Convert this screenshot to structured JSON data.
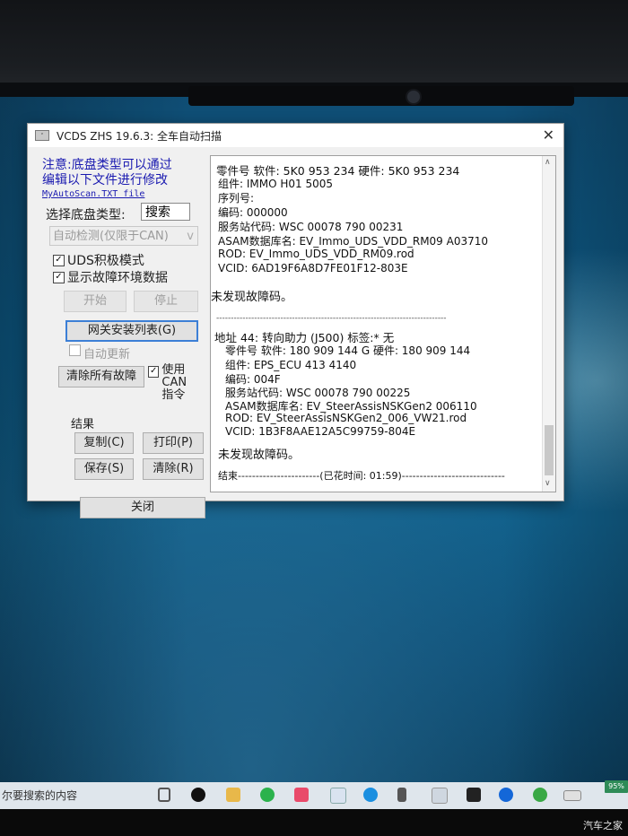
{
  "window": {
    "title": "VCDS ZHS 19.6.3:  全车自动扫描",
    "close_glyph": "✕"
  },
  "left": {
    "note_line1": "注意:底盘类型可以通过",
    "note_line2": "编辑以下文件进行修改",
    "note_file": "MyAutoScan.TXT file",
    "chassis_label": "选择底盘类型:",
    "search_button": "搜索",
    "auto_detect": "自动检测(仅限于CAN)",
    "auto_detect_arrow": "v",
    "uds_active_label": "UDS积极模式",
    "uds_active_checked": true,
    "show_env_label": "显示故障环境数据",
    "show_env_checked": true,
    "start_button": "开始",
    "stop_button": "停止",
    "gateway_button": "网关安装列表(G)",
    "auto_update_label": "自动更新",
    "auto_update_checked": false,
    "clear_all_button": "清除所有故障",
    "use_can_label_1": "使用CAN",
    "use_can_label_2": "指令",
    "use_can_checked": true,
    "result_label": "结果",
    "copy_button": "复制(C)",
    "print_button": "打印(P)",
    "save_button": "保存(S)",
    "clear_button": "清除(R)",
    "close_button": "关闭"
  },
  "output": {
    "lines": [
      "零件号 软件: 5K0 953 234      硬件: 5K0 953 234",
      "组件: IMMO          H01 5005",
      "序列号:",
      "编码: 000000",
      "服务站代码: WSC 00078 790 00231",
      "ASAM数据库名: EV_Immo_UDS_VDD_RM09 A03710",
      "ROD: EV_Immo_UDS_VDD_RM09.rod",
      "VCID: 6AD19F6A8D7FE01F12-803E",
      "未发现故障码。",
      "-------------------------------------------------------------------------------",
      "地址 44: 转向助力 (J500)          标签:* 无",
      "零件号 软件: 180 909 144 G    硬件: 180 909 144",
      "组件: EPS_ECU          413 4140",
      "编码: 004F",
      "服务站代码: WSC 00078 790 00225",
      "ASAM数据库名: EV_SteerAssisNSKGen2 006110",
      "ROD: EV_SteerAssisNSKGen2_006_VW21.rod",
      "VCID: 1B3F8AAE12A5C99759-804E",
      "未发现故障码。",
      "结束-----------------------(已花时间: 01:59)-----------------------------"
    ]
  },
  "taskbar": {
    "search_text": "尔要搜索的内容",
    "battery": "95%"
  },
  "watermark": "汽车之家"
}
